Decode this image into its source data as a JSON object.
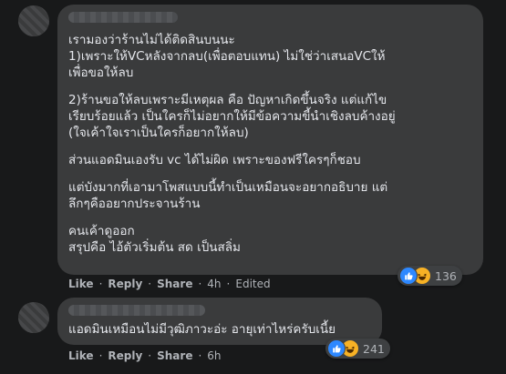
{
  "comment1": {
    "paragraphs": [
      "เรามองว่าร้านไม่ได้ติดสินบนนะ\n1)เพราะให้VCหลังจากลบ(เพื่อตอบแทน) ไม่ใช่ว่าเสนอVCให้\nเพื่อขอให้ลบ",
      "2)ร้านขอให้ลบเพราะมีเหตุผล คือ ปัญหาเกิดขึ้นจริง แต่แก้ไข\nเรียบร้อยแล้ว เป็นใครก็ไม่อยากให้มีข้อความขี้นำเชิงลบค้างอยู่\n(ใจเค้าใจเราเป็นใครก็อยากให้ลบ)",
      "ส่วนแอดมินเองรับ vc ได้ไม่ผิด เพราะของฟรีใครๆก็ชอบ",
      "แต่บังมากที่เอามาโพสแบบนี้ทำเป็นเหมือนจะอยากอธิบาย แต่\nลึกๆคืออยากประจานร้าน",
      "คนเค้าดูออก\nสรุปคือ ไอ้ตัวเริ่มต้น สด เป็นสลิ่ม"
    ],
    "reaction_count": "136",
    "actions": {
      "like": "Like",
      "reply": "Reply",
      "share": "Share",
      "time": "4h",
      "edited": "Edited"
    }
  },
  "comment2": {
    "paragraphs": [
      "แอดมินเหมือนไม่มีวุฒิภาวะอ่ะ อายุเท่าไหร่ครับเนี้ย"
    ],
    "reaction_count": "241",
    "actions": {
      "like": "Like",
      "reply": "Reply",
      "share": "Share",
      "time": "6h"
    }
  },
  "separator": "·",
  "colors": {
    "background": "#18191a",
    "bubble": "#3a3b3c",
    "text": "#e4e6eb",
    "secondary_text": "#b0b3b8",
    "like_blue": "#2d88ff",
    "haha_yellow": "#f7b125"
  },
  "icons": [
    "like-icon",
    "haha-icon"
  ]
}
